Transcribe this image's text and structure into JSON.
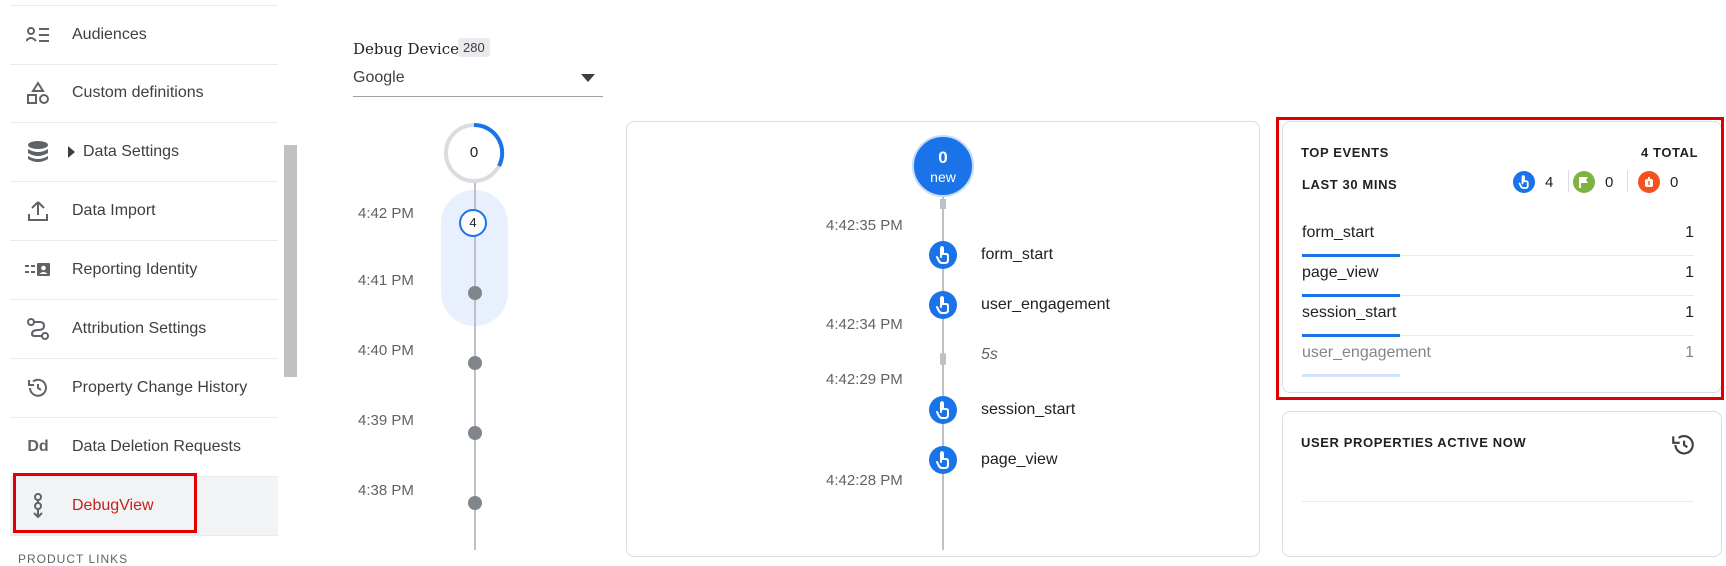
{
  "sidebar": {
    "items": [
      {
        "label": "Audiences",
        "icon": "audiences-icon"
      },
      {
        "label": "Custom definitions",
        "icon": "shapes-icon"
      },
      {
        "label": "Data Settings",
        "icon": "database-icon"
      },
      {
        "label": "Data Import",
        "icon": "upload-icon"
      },
      {
        "label": "Reporting Identity",
        "icon": "identity-icon"
      },
      {
        "label": "Attribution Settings",
        "icon": "route-icon"
      },
      {
        "label": "Property Change History",
        "icon": "history-icon"
      },
      {
        "label": "Data Deletion Requests",
        "icon": "dd-icon"
      },
      {
        "label": "DebugView",
        "icon": "debug-icon"
      }
    ],
    "dd_glyph": "Dd",
    "section_label": "PRODUCT LINKS"
  },
  "device": {
    "label": "Debug Device",
    "count": "280",
    "selected": "Google"
  },
  "minutes": {
    "ring_value": "0",
    "active_count": "4",
    "times": [
      "4:42 PM",
      "4:41 PM",
      "4:40 PM",
      "4:39 PM",
      "4:38 PM"
    ]
  },
  "stream": {
    "new_count": "0",
    "new_label": "new",
    "times": [
      "4:42:35 PM",
      "4:42:34 PM",
      "4:42:29 PM",
      "4:42:28 PM"
    ],
    "events": [
      "form_start",
      "user_engagement",
      "session_start",
      "page_view"
    ],
    "gap_label": "5s"
  },
  "top_events": {
    "title": "TOP EVENTS",
    "total": "4 TOTAL",
    "subtitle": "LAST 30 MINS",
    "counts": [
      {
        "value": "4",
        "color": "#1a73e8",
        "icon": "touch-icon"
      },
      {
        "value": "0",
        "color": "#7cb342",
        "icon": "flag-icon"
      },
      {
        "value": "0",
        "color": "#f4511e",
        "icon": "error-icon"
      }
    ],
    "rows": [
      {
        "name": "form_start",
        "count": "1"
      },
      {
        "name": "page_view",
        "count": "1"
      },
      {
        "name": "session_start",
        "count": "1"
      },
      {
        "name": "user_engagement",
        "count": "1"
      }
    ]
  },
  "user_properties": {
    "title": "USER PROPERTIES ACTIVE NOW"
  },
  "colors": {
    "accent": "#1a73e8",
    "highlight": "#e00000",
    "active_text": "#c5221f"
  }
}
